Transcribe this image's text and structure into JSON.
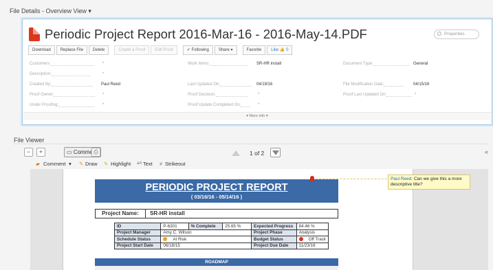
{
  "breadcrumb": {
    "label": "File Details - Overview View",
    "caret": "▾"
  },
  "document": {
    "title": "Periodic Project Report 2016-Mar-16 - 2016-May-14.PDF",
    "icon": "pdf-file-icon"
  },
  "search": {
    "placeholder": "Properties"
  },
  "actions": {
    "download": "Download",
    "replace_file": "Replace File",
    "delete": "Delete",
    "create_proof": "Create a Proof",
    "edit_proof": "Edit Proof",
    "following": "Following",
    "share": "Share",
    "share_caret": "▾",
    "favorite": "Favorite",
    "like": "Like",
    "like_count": "0"
  },
  "fields": {
    "customers": {
      "label": "Customers:",
      "value": ""
    },
    "description": {
      "label": "Description:",
      "value": ""
    },
    "created_by": {
      "label": "Created By:",
      "value": "Paul Reed"
    },
    "proof_owner": {
      "label": "Proof Owner:",
      "value": ""
    },
    "under_proofing": {
      "label": "Under Proofing:",
      "value": ""
    },
    "work_items": {
      "label": "Work Items:",
      "value": "SR-HR install"
    },
    "last_updated_on": {
      "label": "Last Updated On:",
      "value": "04/19/16"
    },
    "proof_decision": {
      "label": "Proof Decision:",
      "value": ""
    },
    "proof_update_completed_on": {
      "label": "Proof Update Completed On:",
      "value": ""
    },
    "document_type": {
      "label": "Document Type:",
      "value": "General"
    },
    "file_modification_date": {
      "label": "File Modification Date:",
      "value": "04/15/16"
    },
    "proof_last_updated_on": {
      "label": "Proof Last Updated On:",
      "value": ""
    },
    "required_mark": "*"
  },
  "more_info": "▾ More info ▾",
  "viewer": {
    "header": "File Viewer",
    "comment_button": "Comment",
    "page_indicator": "1 of 2",
    "collapse": "«"
  },
  "annotation_tools": {
    "comment": "Comment",
    "comment_caret": "▾",
    "draw": "Draw",
    "highlight": "Highlight",
    "text": "Text",
    "strikeout": "Strikeout"
  },
  "report": {
    "title": "PERIODIC PROJECT REPORT",
    "dates": "( 03/16/16 - 05/14/16 )",
    "project_name_label": "Project Name:",
    "project_name": "SR-HR install",
    "rows": [
      {
        "k1": "ID",
        "v1": "P-6301",
        "k1b": "% Complete",
        "v1b": "25.65 %",
        "k2": "Expected Progress",
        "v2": "84.46 %"
      },
      {
        "k1": "Project Manager",
        "v1": "Amy C. Wilson",
        "k2": "Project Phase",
        "v2": "Analysis"
      },
      {
        "k1": "Schedule Status",
        "v1": "At Risk",
        "k2": "Budget Status",
        "v2": "Off Track"
      },
      {
        "k1": "Project Start Date",
        "v1": "06/18/15",
        "k2": "Project Due Date",
        "v2": "11/23/16"
      }
    ],
    "schedule_status_color": "#f0a020",
    "budget_status_color": "#e03020",
    "roadmap": "ROADMAP"
  },
  "sticky_note": {
    "author": "Paul Reed:",
    "text": "Can we give this a more descriptive title?"
  },
  "colors": {
    "banner": "#3b6aa6",
    "accent": "#2a7fc5",
    "pdf_red": "#d9381e"
  }
}
